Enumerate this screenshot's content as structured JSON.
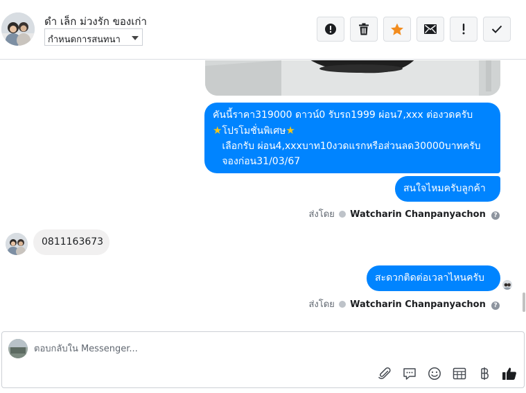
{
  "header": {
    "contact_name": "ดำ เล็ก ม่วงรัก ของเก่า",
    "assign_value": "กำหนดการสนทนา",
    "actions": [
      {
        "name": "mark-spam-button",
        "icon": "alert-circle-icon"
      },
      {
        "name": "delete-button",
        "icon": "trash-icon"
      },
      {
        "name": "star-button",
        "icon": "star-icon"
      },
      {
        "name": "mark-unread-button",
        "icon": "envelope-icon"
      },
      {
        "name": "follow-up-button",
        "icon": "exclamation-icon"
      },
      {
        "name": "mark-done-button",
        "icon": "check-icon"
      }
    ],
    "star_color": "#f28c1e"
  },
  "thread": {
    "messages": [
      {
        "direction": "outgoing",
        "lines": [
          "คันนี้ราคา319000 ดาวน์0  รับรถ1999 ผ่อน7,xxx ต่องวดครับ",
          "โปรโมชั่นพิเศษ",
          "   เลือกรับ ผ่อน4,xxxบาท10งวดแรกหรือส่วนลด30000บาทครับ",
          "   จองก่อน31/03/67"
        ]
      },
      {
        "direction": "outgoing",
        "text": "สนใจไหมครับลูกค้า"
      },
      {
        "direction": "incoming",
        "text": "0811163673"
      },
      {
        "direction": "outgoing",
        "text": "สะดวกติดต่อเวลาไหนครับ"
      }
    ],
    "sent_by_label": "ส่งโดย",
    "sender_name": "Watcharin Chanpanyachon",
    "outgoing_color": "#0084ff",
    "incoming_color": "#f1f0f0"
  },
  "composer": {
    "placeholder": "ตอบกลับใน Messenger...",
    "tools": [
      "paperclip-icon",
      "saved-reply-icon",
      "emoji-icon",
      "appointment-icon",
      "baht-icon",
      "thumbs-up-icon"
    ]
  }
}
